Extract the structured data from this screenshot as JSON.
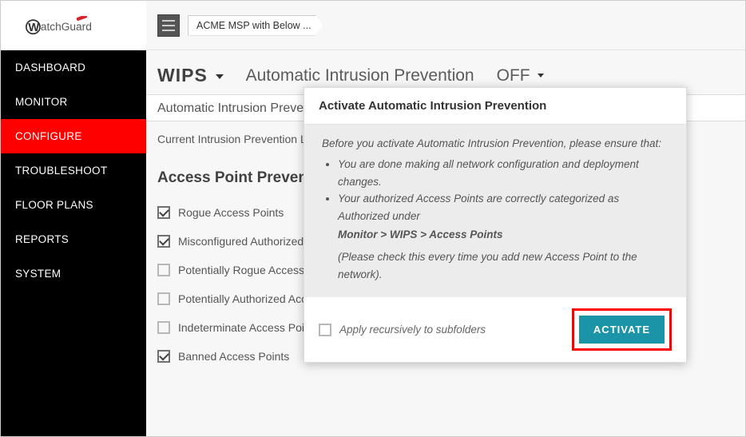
{
  "brand": "WatchGuard",
  "breadcrumb": "ACME MSP with Below ...",
  "nav": {
    "items": [
      {
        "label": "DASHBOARD"
      },
      {
        "label": "MONITOR"
      },
      {
        "label": "CONFIGURE"
      },
      {
        "label": "TROUBLESHOOT"
      },
      {
        "label": "FLOOR PLANS"
      },
      {
        "label": "REPORTS"
      },
      {
        "label": "SYSTEM"
      }
    ]
  },
  "header": {
    "wips": "WIPS",
    "aip": "Automatic Intrusion Prevention",
    "status": "OFF"
  },
  "subheader": "Automatic Intrusion Preven",
  "current_level": "Current Intrusion Prevention Le",
  "section_title": "Access Point Preven",
  "checks": [
    {
      "label": "Rogue Access Points",
      "checked": true
    },
    {
      "label": "Misconfigured Authorized A",
      "checked": true
    },
    {
      "label": "Potentially Rogue Access Po",
      "checked": false
    },
    {
      "label": "Potentially Authorized Access Points",
      "checked": false
    },
    {
      "label": "Indeterminate Access Points",
      "checked": false
    },
    {
      "label": "Banned Access Points",
      "checked": true
    }
  ],
  "modal": {
    "title": "Activate Automatic Intrusion Prevention",
    "intro": "Before you activate Automatic Intrusion Prevention, please ensure that:",
    "bullets": [
      "You are done making all network configuration and deployment changes.",
      "Your authorized Access Points are correctly categorized as Authorized under"
    ],
    "path": "Monitor > WIPS > Access Points",
    "note": "(Please check this every time you add new Access Point to the network).",
    "apply_label": "Apply recursively to subfolders",
    "activate_label": "ACTIVATE"
  }
}
